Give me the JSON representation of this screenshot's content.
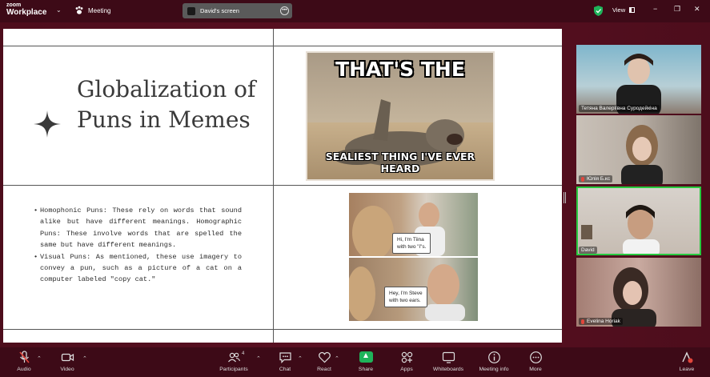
{
  "app": {
    "brand_top": "zoom",
    "brand_bottom": "Workplace",
    "meeting_label": "Meeting"
  },
  "share": {
    "label": "David's screen"
  },
  "view": {
    "label": "View"
  },
  "window": {
    "minimize": "−",
    "restore": "❐",
    "close": "✕"
  },
  "slide": {
    "title": "Globalization of Puns in Memes",
    "bullets": [
      "Homophonic Puns: These rely on words that sound alike but have different meanings. Homographic Puns: These involve words that are spelled the same but have different meanings.",
      "Visual Puns: As mentioned, these use imagery to convey a pun, such as a picture of a cat on a computer labeled \"copy cat.\""
    ],
    "meme1": {
      "top": "THAT'S THE",
      "bottom": "SEALIEST THING I'VE EVER HEARD"
    },
    "meme2": {
      "bubble1_line1": "Hi, I'm Tiina",
      "bubble1_line2": "with two \"i\"s.",
      "bubble2_line1": "Hey, I'm Steve",
      "bubble2_line2": "with two ears."
    }
  },
  "participants": [
    {
      "name": "Тетяна Валеріївна Суродейкіна",
      "muted": false
    },
    {
      "name": "Юлія Б.кс",
      "muted": true
    },
    {
      "name": "David",
      "muted": false,
      "active": true
    },
    {
      "name": "Evelina Horiak",
      "muted": true
    }
  ],
  "toolbar": {
    "audio": "Audio",
    "video": "Video",
    "participants": "Participants",
    "participants_count": "4",
    "chat": "Chat",
    "react": "React",
    "share": "Share",
    "apps": "Apps",
    "whiteboards": "Whiteboards",
    "meeting_info": "Meeting info",
    "more": "More",
    "leave": "Leave"
  },
  "colors": {
    "accent_green": "#1fb35a",
    "active_outline": "#27c93f",
    "muted_red": "#e2463c",
    "topbar": "#3d0a17"
  }
}
